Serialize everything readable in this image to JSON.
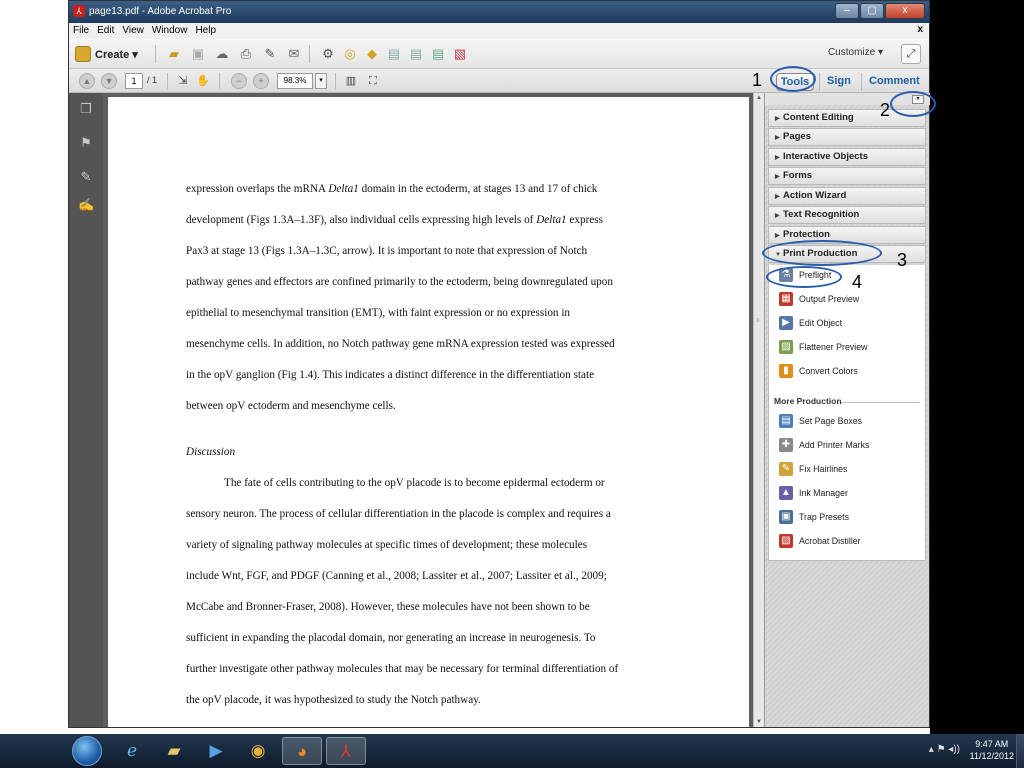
{
  "window": {
    "title": "page13.pdf - Adobe Acrobat Pro",
    "close_glyph": "x",
    "minimize_glyph": "–",
    "maximize_glyph": "▢"
  },
  "menu": {
    "items": [
      "File",
      "Edit",
      "View",
      "Window",
      "Help"
    ],
    "close_glyph": "x"
  },
  "toolbar": {
    "create_label": "Create ▾",
    "customize_label": "Customize ▾",
    "icons": [
      "open-folder-icon",
      "save-icon",
      "cloud-icon",
      "print-icon",
      "edit-icon",
      "email-icon",
      "gear-icon",
      "comment-icon",
      "highlight-icon",
      "document-icon",
      "document-icon",
      "document-icon",
      "pdf-icon"
    ]
  },
  "nav": {
    "page_current": "1",
    "page_total": "/ 1",
    "zoom": "98.3%",
    "zoom_drop": "▾"
  },
  "tabs": {
    "tools": "Tools",
    "sign": "Sign",
    "comment": "Comment"
  },
  "document": {
    "lines": [
      "expression overlaps the mRNA <i>Delta1</i> domain in the ectoderm, at stages 13 and 17 of chick",
      "development (Figs 1.3A–1.3F), also individual cells expressing high levels of <i>Delta1</i> express",
      "Pax3 at stage 13 (Figs 1.3A–1.3C, arrow). It is important to note that expression of Notch",
      "pathway genes and effectors are confined primarily to the ectoderm, being downregulated upon",
      "epithelial to mesenchymal transition (EMT), with faint expression or no expression in",
      "mesenchyme cells. In addition, no Notch pathway gene mRNA expression tested was expressed",
      "in the opV ganglion (Fig 1.4). This indicates a distinct difference in the differentiation state",
      "between opV ectoderm and mesenchyme cells."
    ],
    "heading": "Discussion",
    "lines2": [
      "The fate of cells contributing to the opV placode is to become epidermal ectoderm or",
      "sensory neuron.  The process of cellular differentiation in the placode is complex and requires a",
      "variety of signaling pathway molecules at specific times of development; these molecules",
      "include Wnt, FGF, and PDGF (Canning et al., 2008; Lassiter et al., 2007; Lassiter et al., 2009;",
      "McCabe and Bronner-Fraser, 2008).  However, these molecules have not been shown to be",
      "sufficient in expanding the placodal domain, nor generating an increase in neurogenesis.  To",
      "further investigate other pathway molecules that may be necessary for terminal differentiation of",
      "the opV placode, it was hypothesized to study the Notch pathway."
    ]
  },
  "tools_panel": {
    "sections": [
      "Content Editing",
      "Pages",
      "Interactive Objects",
      "Forms",
      "Action Wizard",
      "Text Recognition",
      "Protection",
      "Print Production"
    ],
    "print_production_items": [
      "Preflight",
      "Output Preview",
      "Edit Object",
      "Flattener Preview",
      "Convert Colors"
    ],
    "more_production_label": "More Production",
    "more_production_items": [
      "Set Page Boxes",
      "Add Printer Marks",
      "Fix Hairlines",
      "Ink Manager",
      "Trap Presets",
      "Acrobat Distiller"
    ]
  },
  "annotations": {
    "n1": "1",
    "n2": "2",
    "n3": "3",
    "n4": "4",
    "oval_color": "#2a5dab"
  },
  "taskbar": {
    "apps": [
      "internet-explorer-icon",
      "file-explorer-icon",
      "media-player-icon",
      "chrome-icon",
      "firefox-icon",
      "acrobat-icon"
    ],
    "time": "9:47 AM",
    "date": "11/12/2012",
    "tray_glyphs": "▴ ⚑ ◂))"
  }
}
